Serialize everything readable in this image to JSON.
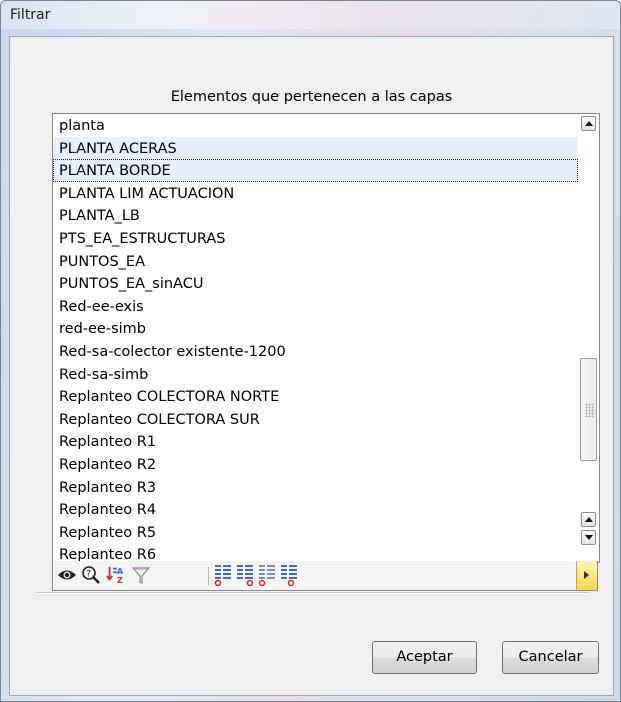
{
  "window": {
    "title": "Filtrar"
  },
  "list": {
    "heading": "Elementos que pertenecen a las capas",
    "items": [
      "planta",
      "PLANTA ACERAS",
      "PLANTA BORDE",
      "PLANTA LIM ACTUACION",
      "PLANTA_LB",
      "PTS_EA_ESTRUCTURAS",
      "PUNTOS_EA",
      "PUNTOS_EA_sinACU",
      "Red-ee-exis",
      "red-ee-simb",
      "Red-sa-colector existente-1200",
      "Red-sa-simb",
      "Replanteo COLECTORA NORTE",
      "Replanteo COLECTORA SUR",
      "Replanteo R1",
      "Replanteo R2",
      "Replanteo R3",
      "Replanteo R4",
      "Replanteo R5",
      "Replanteo R6"
    ],
    "hovered_item": "PLANTA ACERAS",
    "focused_item": "PLANTA BORDE"
  },
  "toolbar": {
    "icons": [
      "eye-icon",
      "query-icon",
      "sort-az-icon",
      "filter-funnel-icon",
      "list-remove-icon",
      "list-remove-icon",
      "list-remove-icon",
      "list-remove-icon",
      "more-arrow-icon"
    ]
  },
  "buttons": {
    "ok": "Aceptar",
    "cancel": "Cancelar"
  },
  "colors": {
    "hover_row": "#e5f0fb",
    "more_button": "#ffd24a"
  }
}
